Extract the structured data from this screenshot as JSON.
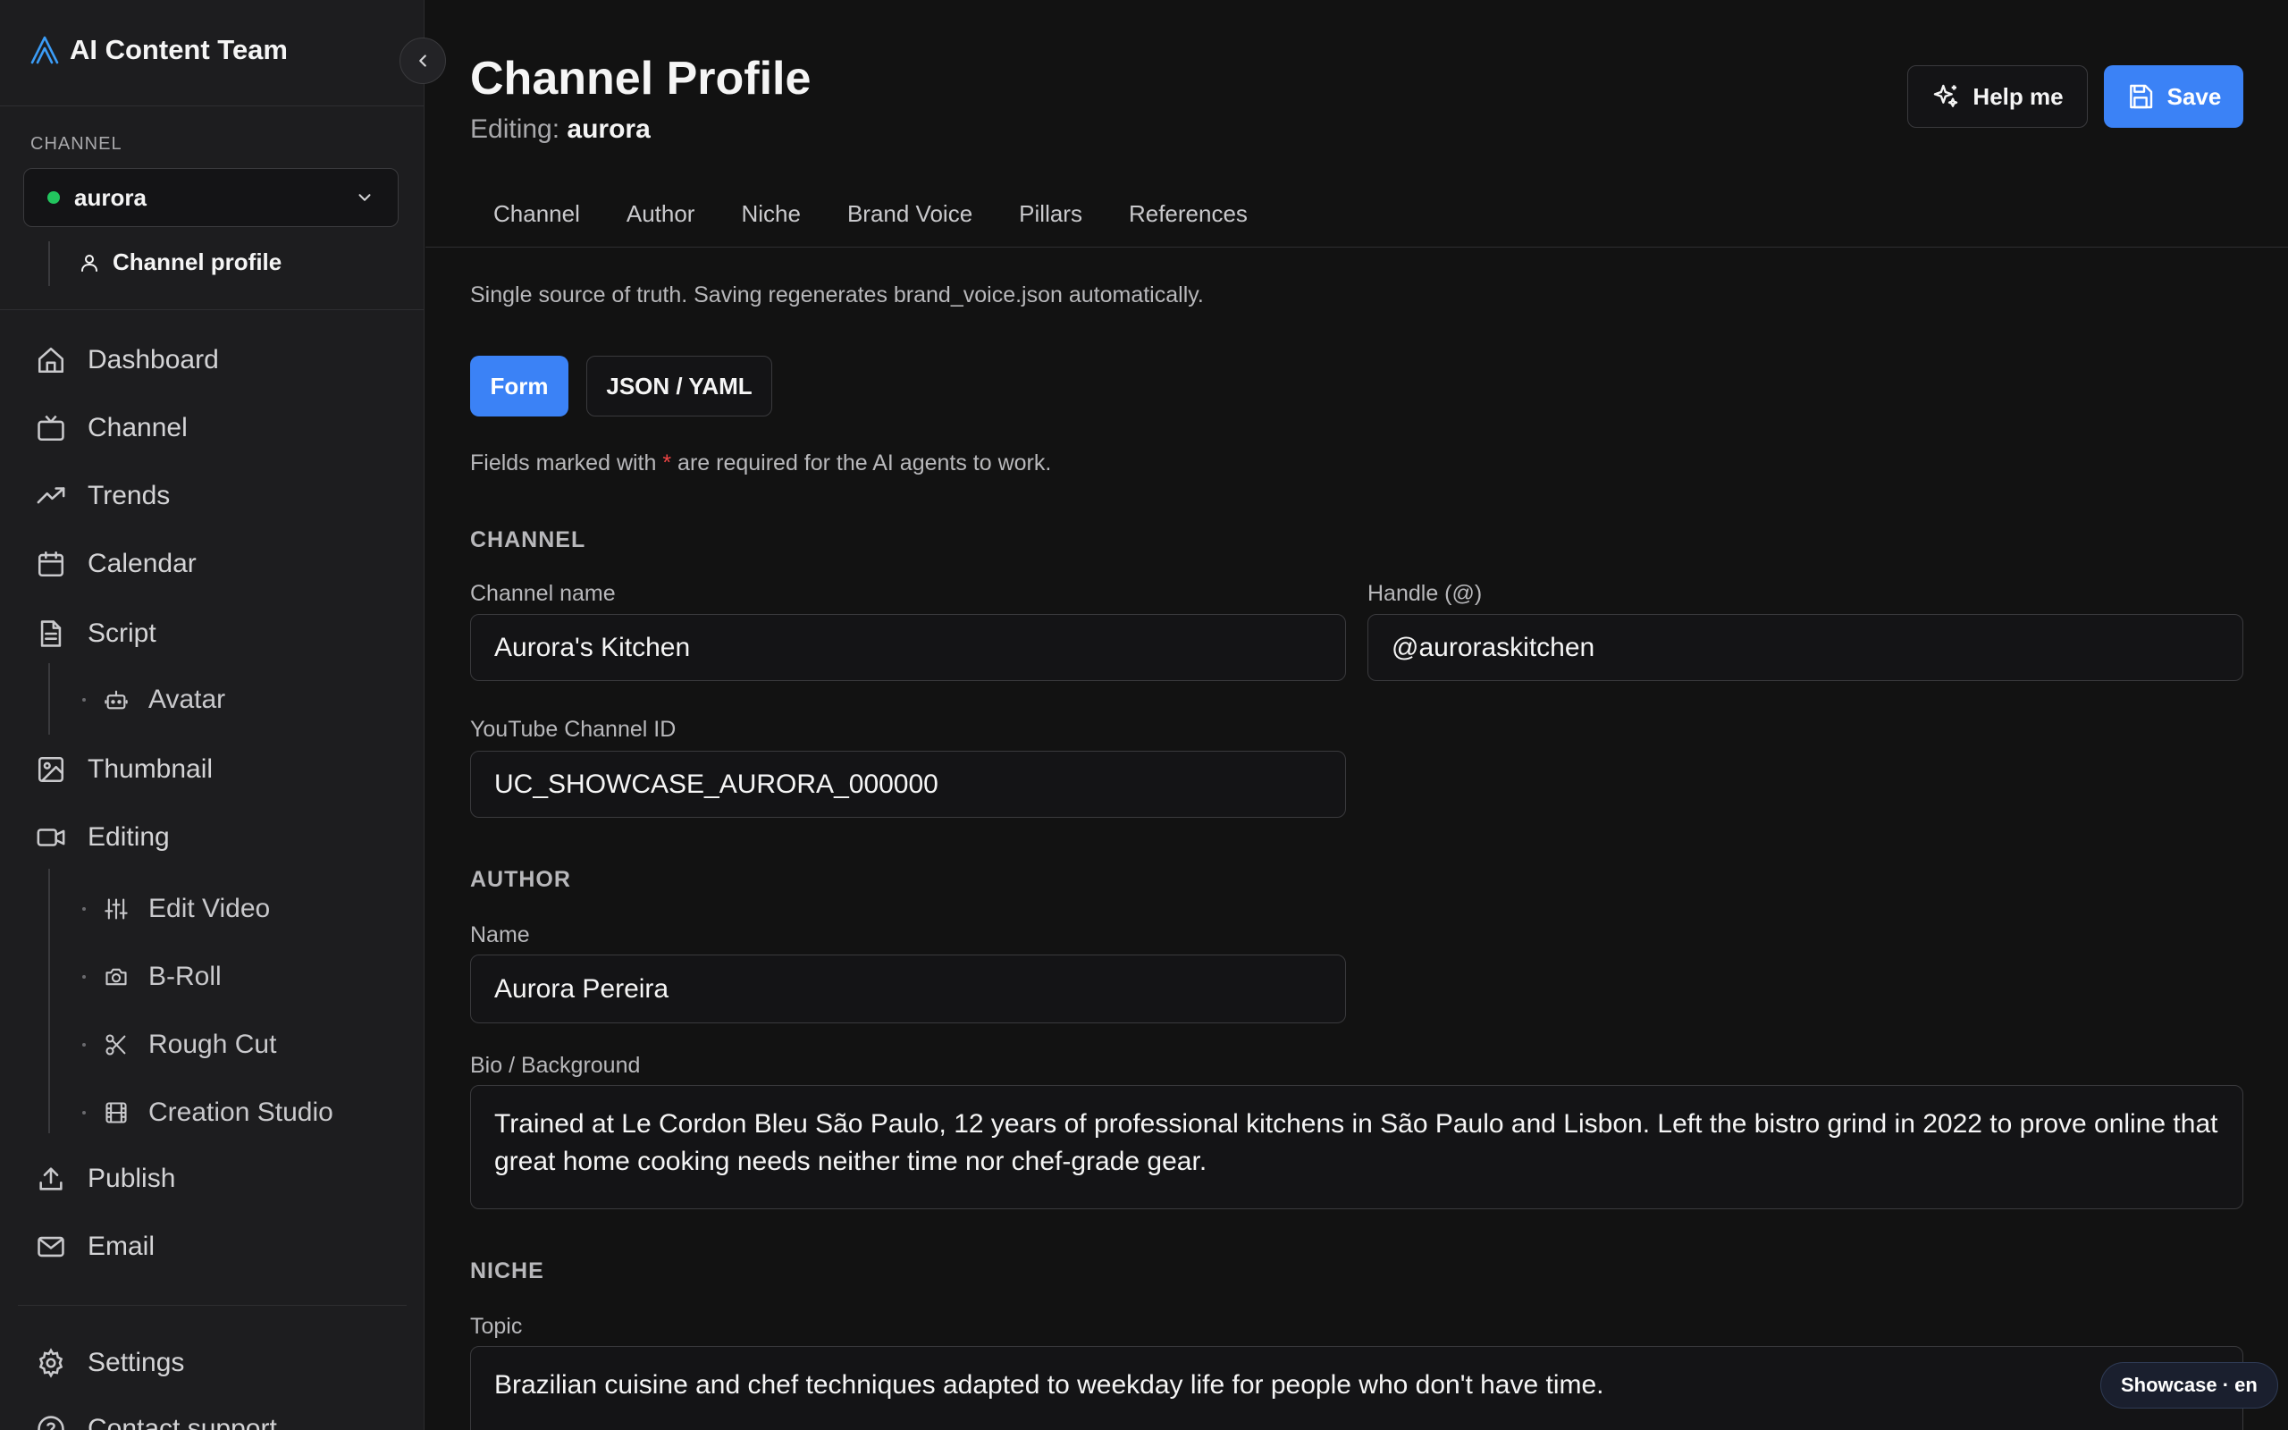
{
  "sidebar": {
    "brand": "AI Content Team",
    "section_label": "CHANNEL",
    "channel_value": "aurora",
    "profile_link": "Channel profile",
    "nav": {
      "dashboard": "Dashboard",
      "channel": "Channel",
      "trends": "Trends",
      "calendar": "Calendar",
      "script": "Script",
      "avatar": "Avatar",
      "thumbnail": "Thumbnail",
      "editing": "Editing",
      "edit_video": "Edit Video",
      "b_roll": "B-Roll",
      "rough_cut": "Rough Cut",
      "creation_studio": "Creation Studio",
      "publish": "Publish",
      "email": "Email",
      "settings": "Settings",
      "contact_support": "Contact support"
    }
  },
  "header": {
    "title": "Channel Profile",
    "editing_prefix": "Editing: ",
    "editing_name": "aurora",
    "help_label": "Help me",
    "save_label": "Save"
  },
  "tabs": [
    "Channel",
    "Author",
    "Niche",
    "Brand Voice",
    "Pillars",
    "References"
  ],
  "intro_note": "Single source of truth. Saving regenerates brand_voice.json automatically.",
  "mode": {
    "form": "Form",
    "json": "JSON / YAML"
  },
  "required_note": {
    "before": "Fields marked with ",
    "star": "*",
    "after": " are required for the AI agents to work."
  },
  "sections": {
    "channel": {
      "heading": "CHANNEL",
      "name_label": "Channel name",
      "name_value": "Aurora's Kitchen",
      "handle_label": "Handle (@)",
      "handle_value": "@auroraskitchen",
      "yt_label": "YouTube Channel ID",
      "yt_value": "UC_SHOWCASE_AURORA_000000"
    },
    "author": {
      "heading": "AUTHOR",
      "name_label": "Name",
      "name_value": "Aurora Pereira",
      "bio_label": "Bio / Background",
      "bio_value": "Trained at Le Cordon Bleu São Paulo, 12 years of professional kitchens in São Paulo and Lisbon. Left the bistro grind in 2022 to prove online that great home cooking needs neither time nor chef-grade gear."
    },
    "niche": {
      "heading": "NICHE",
      "topic_label": "Topic",
      "topic_value": "Brazilian cuisine and chef techniques adapted to weekday life for people who don't have time."
    }
  },
  "badge": "Showcase · en",
  "colors": {
    "accent": "#3b82f6",
    "status_online": "#22c55e",
    "required": "#ef4444"
  }
}
